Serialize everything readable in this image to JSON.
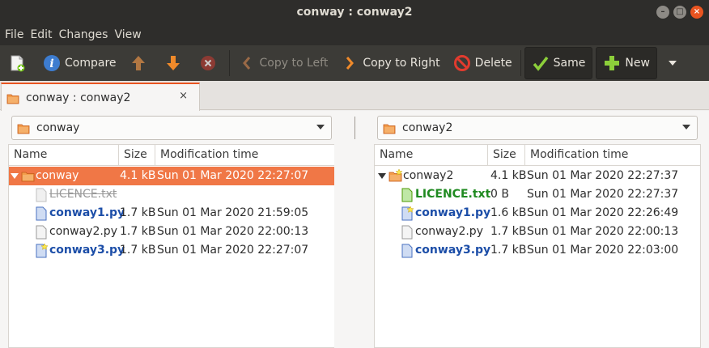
{
  "window": {
    "title": "conway : conway2"
  },
  "menu": [
    "File",
    "Edit",
    "Changes",
    "View"
  ],
  "toolbar": {
    "compare": "Compare",
    "copy_to_left": "Copy to Left",
    "copy_to_right": "Copy to Right",
    "delete": "Delete",
    "same": "Same",
    "new": "New"
  },
  "tab": {
    "label": "conway : conway2",
    "close": "×"
  },
  "left": {
    "folder": "conway",
    "columns": {
      "name": "Name",
      "size": "Size",
      "mtime": "Modification time"
    },
    "rows": [
      {
        "name": "conway",
        "size": "4.1 kB",
        "mtime": "Sun 01 Mar 2020 22:27:07",
        "type": "folder",
        "state": "selected"
      },
      {
        "name": "LICENCE.txt",
        "size": "",
        "mtime": "",
        "type": "file",
        "state": "removed"
      },
      {
        "name": "conway1.py",
        "size": "1.7 kB",
        "mtime": "Sun 01 Mar 2020 21:59:05",
        "type": "file",
        "state": "modified"
      },
      {
        "name": "conway2.py",
        "size": "1.7 kB",
        "mtime": "Sun 01 Mar 2020 22:00:13",
        "type": "file",
        "state": "same"
      },
      {
        "name": "conway3.py",
        "size": "1.7 kB",
        "mtime": "Sun 01 Mar 2020 22:27:07",
        "type": "file",
        "state": "modified-newer"
      }
    ]
  },
  "right": {
    "folder": "conway2",
    "columns": {
      "name": "Name",
      "size": "Size",
      "mtime": "Modification time"
    },
    "rows": [
      {
        "name": "conway2",
        "size": "4.1 kB",
        "mtime": "Sun 01 Mar 2020 22:27:37",
        "type": "folder",
        "state": "folder-newer"
      },
      {
        "name": "LICENCE.txt",
        "size": "0 B",
        "mtime": "Sun 01 Mar 2020 22:27:37",
        "type": "file",
        "state": "new"
      },
      {
        "name": "conway1.py",
        "size": "1.6 kB",
        "mtime": "Sun 01 Mar 2020 22:26:49",
        "type": "file",
        "state": "modified-newer"
      },
      {
        "name": "conway2.py",
        "size": "1.7 kB",
        "mtime": "Sun 01 Mar 2020 22:00:13",
        "type": "file",
        "state": "same"
      },
      {
        "name": "conway3.py",
        "size": "1.7 kB",
        "mtime": "Sun 01 Mar 2020 22:03:00",
        "type": "file",
        "state": "modified"
      }
    ]
  },
  "colors": {
    "accent": "#e95420",
    "selected_row": "#f07746",
    "modified_text": "#1c4ea8",
    "new_text": "#1f8a20",
    "removed_text": "#9a9a9a"
  }
}
